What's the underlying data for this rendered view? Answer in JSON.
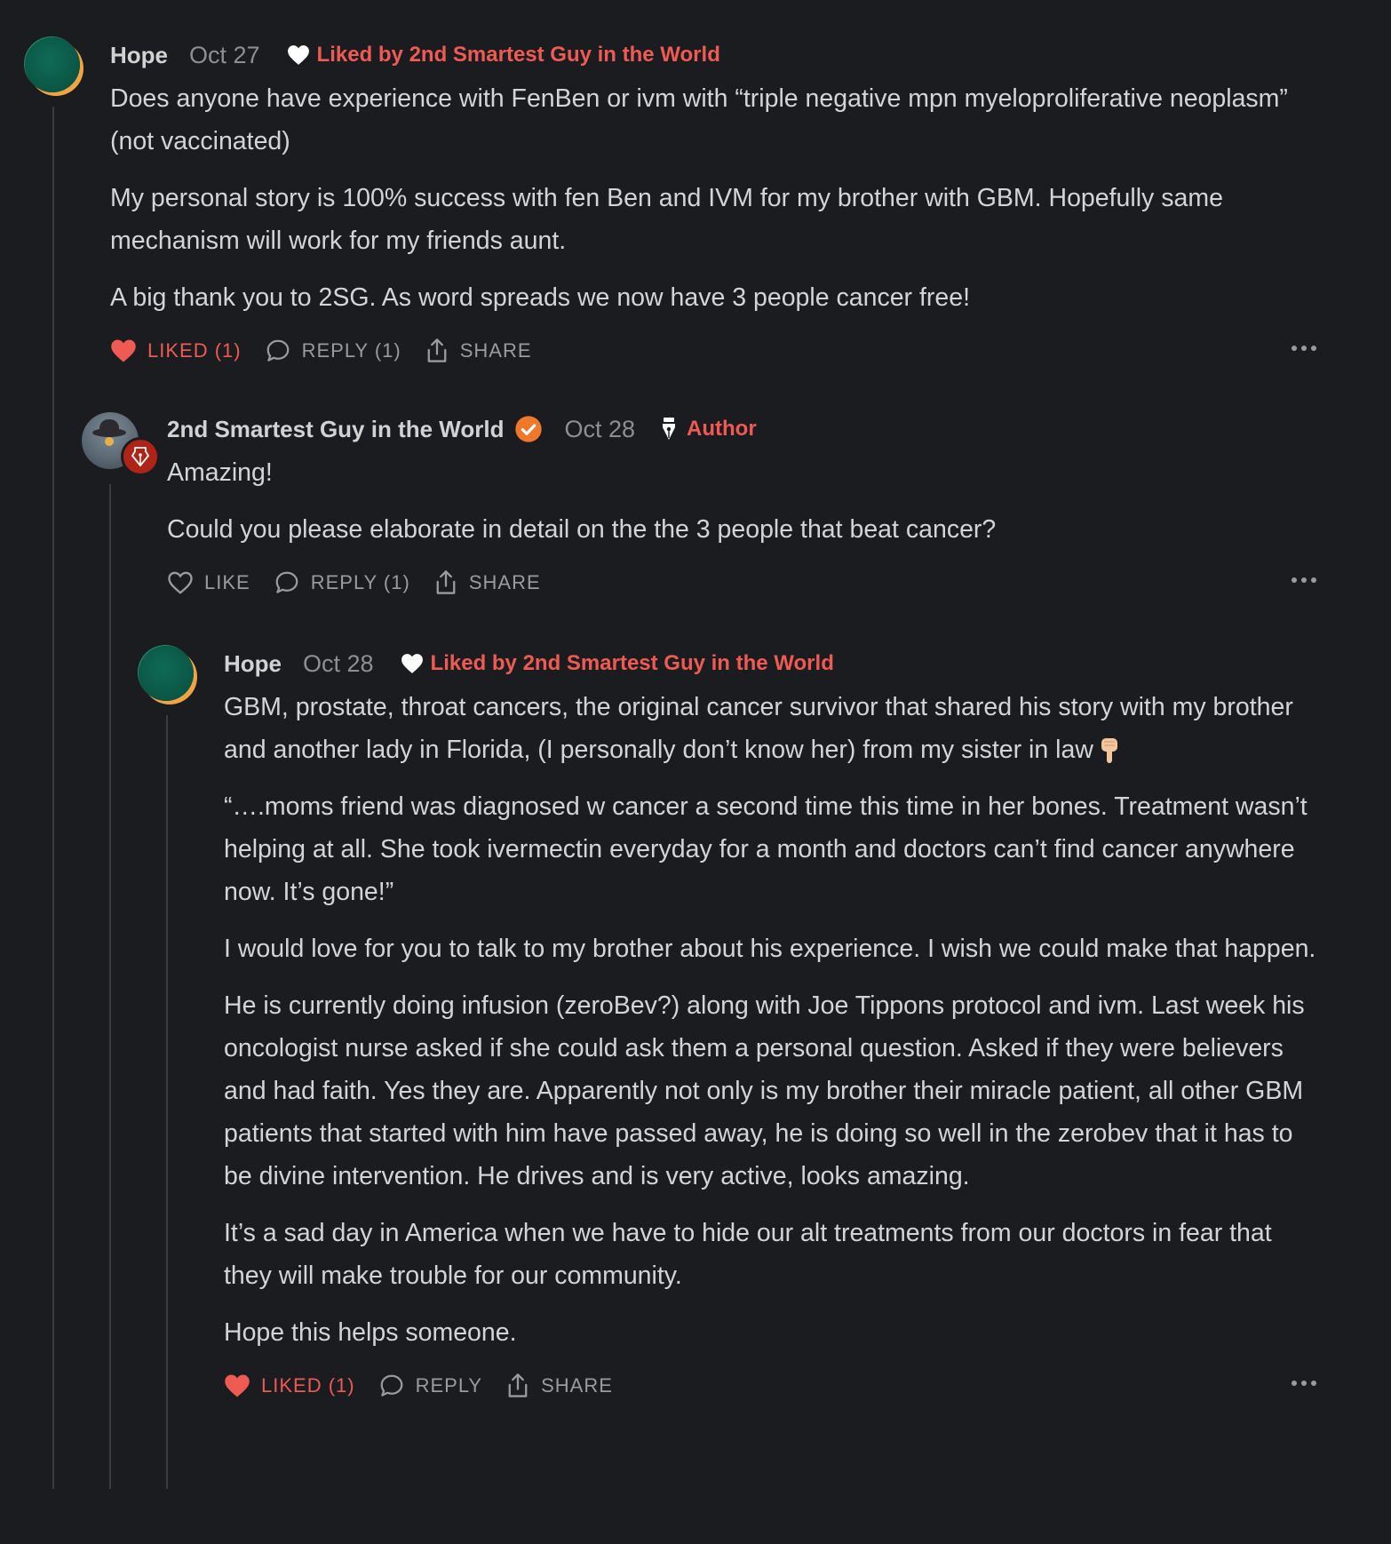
{
  "comments": [
    {
      "author": "Hope",
      "date": "Oct 27",
      "liked_by": "Liked by 2nd Smartest Guy in the World",
      "paragraphs": [
        "Does anyone have experience with FenBen or ivm with “triple negative mpn myeloproliferative neoplasm” (not vaccinated)",
        "My personal story is 100% success with fen Ben and IVM for my brother with GBM. Hopefully same mechanism will work for my friends aunt.",
        "A big thank you to 2SG. As word spreads we now have 3 people cancer free!"
      ],
      "actions": {
        "like": "LIKED (1)",
        "reply": "REPLY (1)",
        "share": "SHARE"
      }
    },
    {
      "author": "2nd Smartest Guy in the World",
      "date": "Oct 28",
      "author_badge": "Author",
      "paragraphs": [
        "Amazing!",
        "Could you please elaborate in detail on the the 3 people that beat cancer?"
      ],
      "actions": {
        "like": "LIKE",
        "reply": "REPLY (1)",
        "share": "SHARE"
      }
    },
    {
      "author": "Hope",
      "date": "Oct 28",
      "liked_by": "Liked by 2nd Smartest Guy in the World",
      "paragraphs": [
        "GBM, prostate, throat cancers, the original cancer survivor that shared his story with my brother and another lady in Florida, (I personally don’t know her) from my sister in law",
        "“….moms friend was diagnosed w cancer a second time this time in her bones. Treatment wasn’t helping at all. She took ivermectin everyday for a month and doctors can’t find cancer anywhere now. It’s gone!”",
        "I would love for you to talk to my brother about his experience. I wish we could make that happen.",
        "He is currently doing infusion (zeroBev?) along with Joe Tippons protocol and ivm. Last week his oncologist nurse asked if she could ask them a personal question. Asked if they were believers and had faith. Yes they are. Apparently not only is my brother their miracle patient, all other GBM patients that started with him have passed away, he is doing so well in the zerobev that it has to be divine intervention. He drives and is very active, looks amazing.",
        "It’s a sad day in America when we have to hide our alt treatments from our doctors in fear that they will make trouble for our community.",
        "Hope this helps someone."
      ],
      "actions": {
        "like": "LIKED (1)",
        "reply": "REPLY",
        "share": "SHARE"
      }
    }
  ],
  "icons": {
    "heart_filled": "heart-filled-icon",
    "heart_outline": "heart-outline-icon",
    "reply": "speech-bubble-icon",
    "share": "share-icon",
    "more": "more-dots-icon",
    "verified": "verified-check-icon",
    "pen_nib": "pen-nib-icon",
    "pointing_down": "pointing-down-emoji"
  },
  "colors": {
    "background": "#1b1c20",
    "accent": "#ef5a52",
    "verified": "#f0782a",
    "muted": "#8e8e93"
  }
}
